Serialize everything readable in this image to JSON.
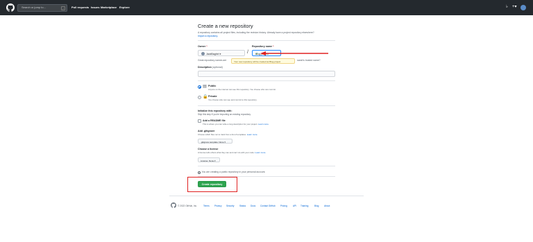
{
  "header": {
    "search_placeholder": "Search or jump to...",
    "search_shortcut": "/",
    "nav": [
      "Pull requests",
      "Issues",
      "Marketplace",
      "Explore"
    ],
    "icons": [
      "bell-icon",
      "plus-icon",
      "avatar"
    ]
  },
  "page": {
    "title": "Create a new repository",
    "subtitle": "A repository contains all project files, including the revision history. Already have a project repository elsewhere?",
    "import_link": "Import a repository."
  },
  "form": {
    "owner_label": "Owner",
    "repo_label": "Repository name",
    "required_mark": "*",
    "owner_value": "JackBaghel",
    "slash": "/",
    "repo_value": "Blog-project",
    "tooltip": "Your new repository will be created as Blog-project",
    "hint_left": "Great repository names are",
    "hint_right": "sarah’s trusted name?",
    "description_label": "Description",
    "description_optional": "(optional)"
  },
  "visibility": {
    "public_title": "Public",
    "public_desc": "Anyone on the internet can see this repository. You choose who can commit.",
    "private_title": "Private",
    "private_desc": "You choose who can see and commit to this repository.",
    "selected": "public"
  },
  "init": {
    "title": "Initialize this repository with:",
    "subtitle": "Skip this step if you’re importing an existing repository.",
    "readme_label": "Add a README file",
    "readme_desc": "This is where you can write a long description for your project.",
    "readme_link": "Learn more.",
    "gitignore_title": "Add .gitignore",
    "gitignore_desc": "Choose which files not to track from a list of templates.",
    "gitignore_link": "Learn more.",
    "gitignore_select": ".gitignore template: None ▾",
    "license_title": "Choose a license",
    "license_desc": "A license tells others what they can and can't do with your code.",
    "license_link": "Learn more.",
    "license_select": "License: None ▾"
  },
  "info_note": "You are creating a public repository in your personal account.",
  "create_button": "Create repository",
  "footer": {
    "copyright": "© 2022 GitHub, Inc.",
    "links": [
      "Terms",
      "Privacy",
      "Security",
      "Status",
      "Docs",
      "Contact GitHub",
      "Pricing",
      "API",
      "Training",
      "Blog",
      "About"
    ]
  },
  "colors": {
    "header_bg": "#24292e",
    "create_green": "#2ea44f",
    "annotation_red": "#e02020",
    "link_blue": "#0366d6"
  }
}
